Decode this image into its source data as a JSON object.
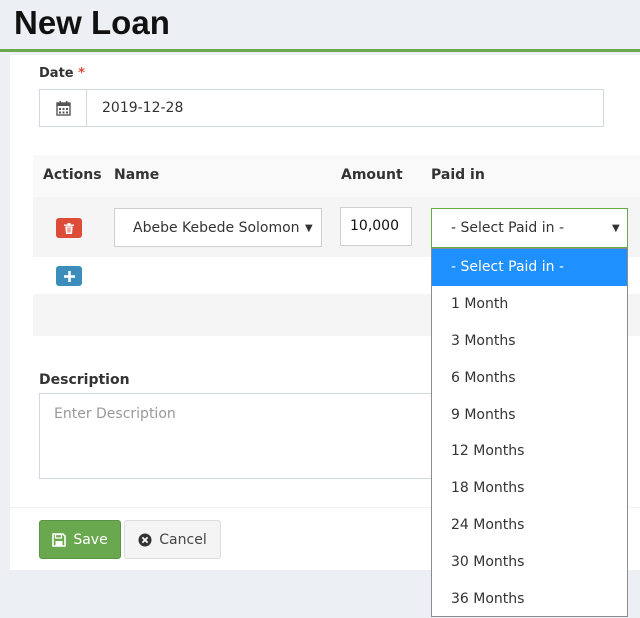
{
  "header": {
    "title": "New Loan"
  },
  "form": {
    "date_label": "Date",
    "required_mark": "*",
    "date_value": "2019-12-28",
    "description_label": "Description",
    "description_placeholder": "Enter Description"
  },
  "table": {
    "headers": [
      "Actions",
      "Name",
      "Amount",
      "Paid in"
    ],
    "row": {
      "name": "Abebe Kebede Solomon",
      "amount": "10,000",
      "paid_in": "- Select Paid in -"
    }
  },
  "paid_in_options": [
    "- Select Paid in -",
    "1 Month",
    "3 Months",
    "6 Months",
    "9 Months",
    "12 Months",
    "18 Months",
    "24 Months",
    "30 Months",
    "36 Months"
  ],
  "buttons": {
    "save": "Save",
    "cancel": "Cancel"
  },
  "colors": {
    "accent_green": "#6aa84f",
    "danger_red": "#dd4b39",
    "info_blue": "#3c8dbc",
    "selected_blue": "#1e90ff"
  }
}
